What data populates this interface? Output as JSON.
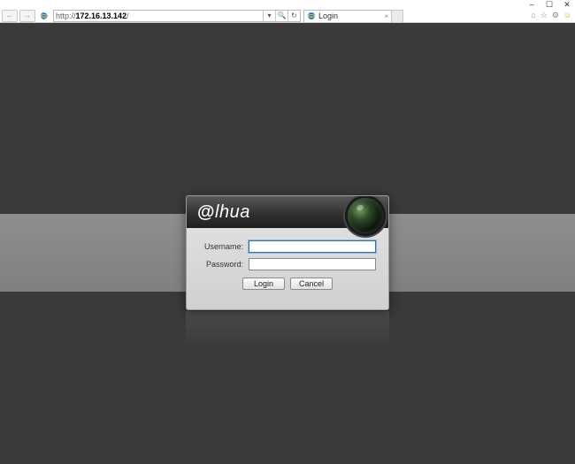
{
  "window": {
    "controls": {
      "minimize": "–",
      "maximize": "☐",
      "close": "✕"
    }
  },
  "toolbar": {
    "back": "←",
    "forward": "→",
    "url_prefix": "http://",
    "url_host": "172.16.13.142",
    "url_suffix": "/",
    "search_glyph": "🔍",
    "search_sep": "▾",
    "refresh": "↻",
    "icons": {
      "home": "⌂",
      "star": "☆",
      "gear": "⚙",
      "smiley": "☺"
    }
  },
  "tab": {
    "title": "Login",
    "close": "×"
  },
  "login": {
    "brand_at": "@",
    "brand_rest": "lhua",
    "username_label": "Username:",
    "password_label": "Password:",
    "username_value": "",
    "password_value": "",
    "login_btn": "Login",
    "cancel_btn": "Cancel"
  }
}
